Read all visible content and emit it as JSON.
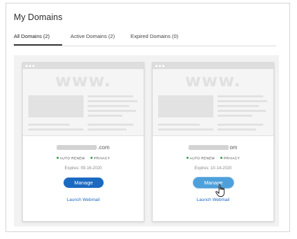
{
  "page": {
    "title": "My Domains"
  },
  "tabs": [
    {
      "label": "All Domains (2)",
      "active": true
    },
    {
      "label": "Active Domains (2)",
      "active": false
    },
    {
      "label": "Expired Domains (0)",
      "active": false
    }
  ],
  "cards": [
    {
      "placeholder_text": "www.",
      "domain_suffix": ".com",
      "badges": [
        "AUTO RENEW",
        "PRIVACY"
      ],
      "expires": "Expires: 09-16-2020",
      "manage_label": "Manage",
      "webmail_label": "Launch Webmail"
    },
    {
      "placeholder_text": "www.",
      "domain_suffix": "om",
      "badges": [
        "AUTO RENEW",
        "PRIVACY"
      ],
      "expires": "Expires: 10-14-2020",
      "manage_label": "Manage",
      "webmail_label": "Launch Webmail"
    }
  ],
  "colors": {
    "primary_button": "#1b6ac1",
    "hover_button": "#4ea0db",
    "status_green": "#2f9e44",
    "link": "#1b6ac1"
  },
  "icons": [
    "hand-pointer-icon"
  ]
}
